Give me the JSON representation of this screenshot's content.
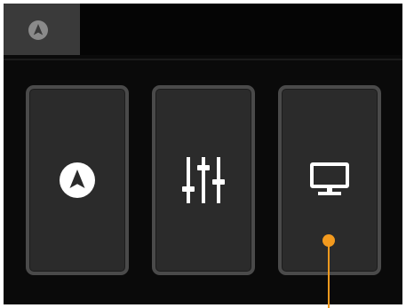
{
  "tabs": [
    {
      "icon": "navigation-icon",
      "selected": true
    }
  ],
  "tiles": [
    {
      "icon": "navigation-icon"
    },
    {
      "icon": "sliders-icon"
    },
    {
      "icon": "monitor-icon"
    }
  ],
  "colors": {
    "screen_bg": "#0a0a0a",
    "tile_bg": "#2b2b2b",
    "tile_border": "#4a4a4a",
    "tab_selected": "#3a3a3a",
    "icon": "#ffffff",
    "pointer": "#f39a1e"
  }
}
